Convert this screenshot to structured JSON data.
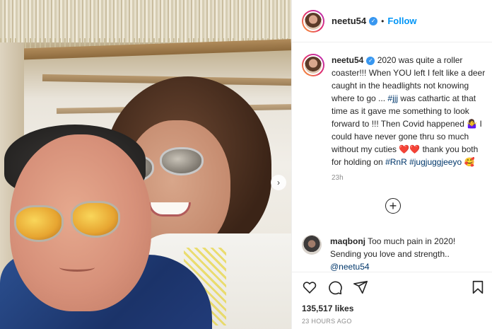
{
  "post": {
    "username": "neetu54",
    "verified_mark": "✓",
    "separator": "•",
    "follow_label": "Follow",
    "caption": {
      "username": "neetu54",
      "part1": " 2020 was quite a roller coaster!!! When YOU left I felt like a deer caught in the headlights not knowing where to go ... ",
      "tag1": "#jjj",
      "part2": " was cathartic at that time as it gave me something to look forward to !!! Then Covid happened 🤷‍♀️ I could have never gone thru so much without my cuties ❤️❤️ thank you both for holding on ",
      "tag2": "#RnR",
      "tag3": "#jugjuggjeeyo",
      "part3": " 🥰",
      "time": "23h"
    },
    "add_comment_glyph": "+",
    "comment": {
      "username": "maqbonj",
      "text": " Too much pain in 2020! Sending you love and strength.. ",
      "mention": "@neetu54"
    },
    "likes": "135,517 likes",
    "posted_ago": "23 HOURS AGO",
    "next_glyph": "›"
  },
  "icons": {
    "like": "heart-icon",
    "comment": "comment-icon",
    "share": "share-icon",
    "save": "bookmark-icon",
    "next": "chevron-right-icon"
  },
  "colors": {
    "link": "#0095f6",
    "verified": "#3897f0",
    "hashtag": "#00376b",
    "muted": "#8e8e8e"
  }
}
